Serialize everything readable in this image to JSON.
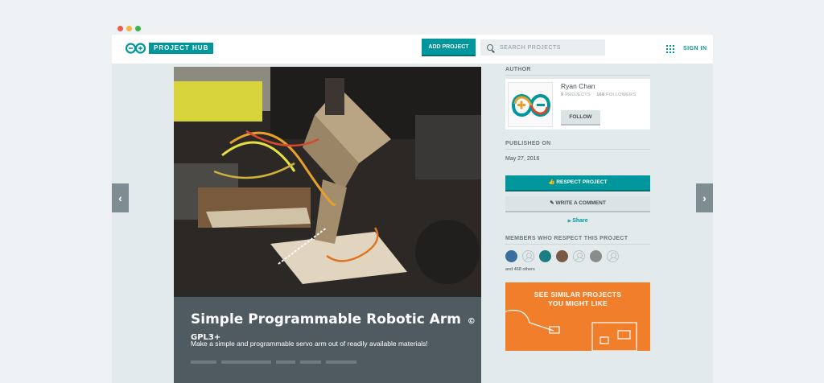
{
  "navbar": {
    "logo_text": "PROJECT HUB",
    "add_project": "ADD PROJECT",
    "search_placeholder": "SEARCH PROJECTS",
    "sign_in": "SIGN IN"
  },
  "project": {
    "title": "Simple Programmable Robotic Arm",
    "license": "© GPL3+",
    "description": "Make a simple and programmable servo arm out of readily available materials!"
  },
  "author": {
    "section_label": "AUTHOR",
    "name": "Ryan Chan",
    "projects_count": "9",
    "projects_label": "PROJECTS",
    "followers_count": "168",
    "followers_label": "FOLLOWERS",
    "follow_label": "FOLLOW"
  },
  "published": {
    "label": "PUBLISHED ON",
    "date": "May 27, 2016"
  },
  "actions": {
    "respect": "RESPECT PROJECT",
    "comment": "WRITE A COMMENT",
    "share": "Share"
  },
  "members": {
    "label": "MEMBERS WHO RESPECT THIS PROJECT",
    "others": "and 468 others"
  },
  "similar": {
    "line1": "SEE SIMILAR PROJECTS",
    "line2": "YOU MIGHT LIKE"
  },
  "colors": {
    "teal": "#00979c",
    "orange": "#f07e2a",
    "caption_bg": "#4f5b60"
  }
}
